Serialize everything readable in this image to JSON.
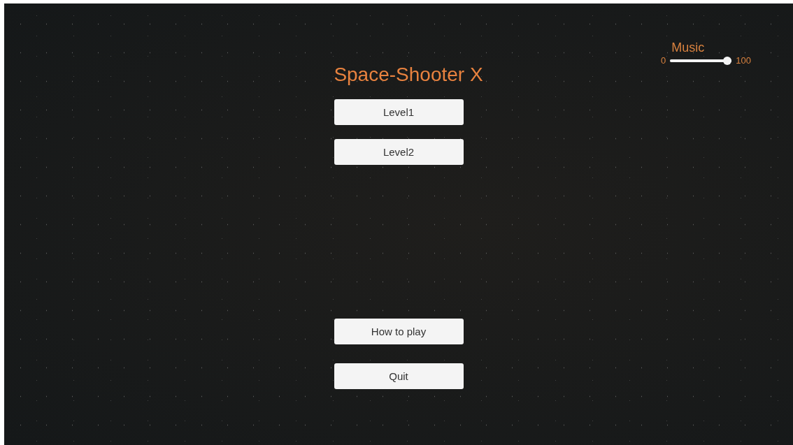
{
  "title": "Space-Shooter X",
  "buttons": [
    {
      "label": "Level1"
    },
    {
      "label": "Level2"
    },
    {
      "label": "How to play"
    },
    {
      "label": "Quit"
    }
  ],
  "music": {
    "label": "Music",
    "min_label": "0",
    "max_label": "100",
    "level": 1
  }
}
